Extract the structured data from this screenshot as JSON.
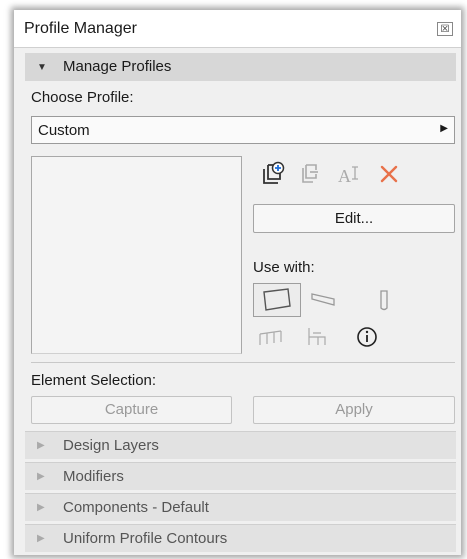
{
  "window": {
    "title": "Profile Manager",
    "close_glyph": "☒"
  },
  "manage_profiles": {
    "header": "Manage Profiles",
    "choose_profile_label": "Choose Profile:",
    "selected_profile": "Custom",
    "toolbar_icons": [
      "new-profile-icon",
      "duplicate-profile-icon",
      "rename-profile-icon",
      "delete-profile-icon"
    ],
    "edit_button": "Edit...",
    "use_with_label": "Use with:",
    "use_with_icons": [
      "wall-icon",
      "beam-icon",
      "column-icon",
      "railing-icon",
      "stair-icon",
      "info-icon"
    ]
  },
  "element_selection": {
    "label": "Element Selection:",
    "capture_button": "Capture",
    "apply_button": "Apply"
  },
  "collapsed_sections": [
    {
      "label": "Design Layers"
    },
    {
      "label": "Modifiers"
    },
    {
      "label": "Components - Default"
    },
    {
      "label": "Uniform Profile Contours"
    }
  ],
  "colors": {
    "delete_icon": "#e8714a",
    "header_bg": "#d7d7d7",
    "panel_bg": "#f0f0f0"
  }
}
